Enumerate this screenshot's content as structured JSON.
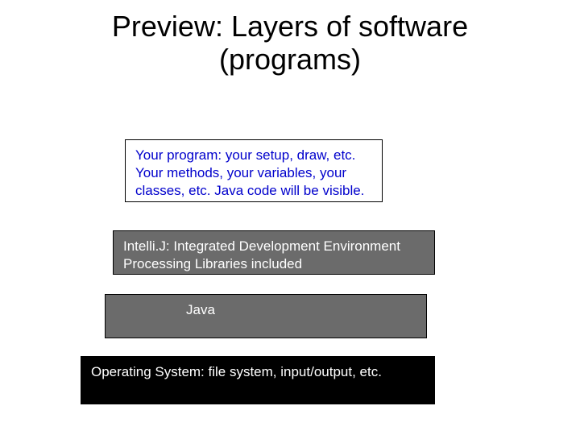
{
  "title": "Preview: Layers of software\n(programs)",
  "layers": {
    "program": "Your program: your setup, draw, etc. Your methods, your variables, your classes, etc. Java code will be visible.",
    "intellij": "Intelli.J: Integrated Development Environment Processing Libraries included",
    "java": "Java",
    "os": "Operating System: file system, input/output, etc."
  }
}
